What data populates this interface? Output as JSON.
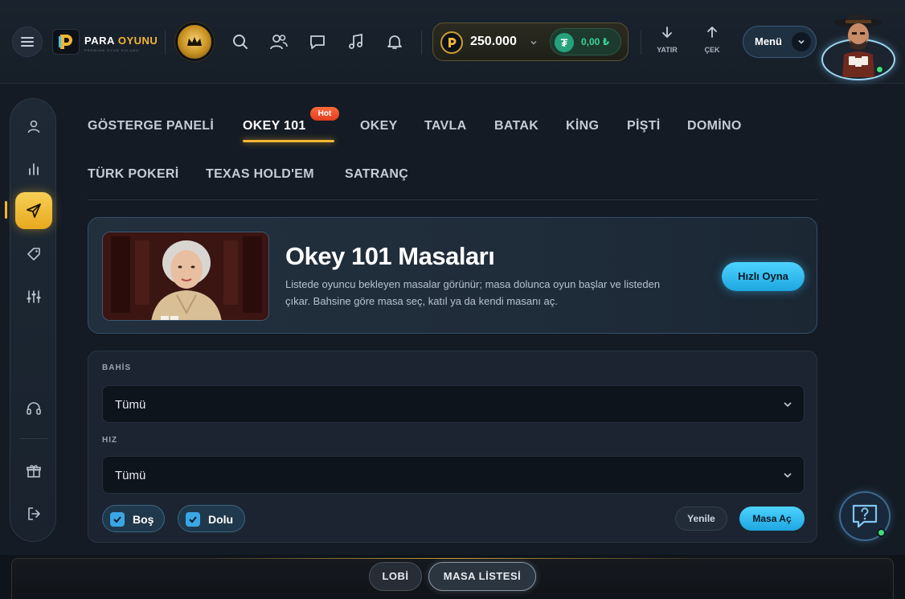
{
  "header": {
    "logo_word1": "PARA",
    "logo_word2": "OYUNU",
    "logo_tagline": "PREMIUM OYUN KULUBU",
    "balance": "250.000",
    "usdt_balance": "0,00 ₺",
    "deposit_label": "YATIR",
    "withdraw_label": "ÇEK",
    "menu_label": "Menü"
  },
  "tabs": {
    "items": [
      {
        "label": "GÖSTERGE PANELİ"
      },
      {
        "label": "OKEY 101"
      },
      {
        "label": "OKEY"
      },
      {
        "label": "TAVLA"
      },
      {
        "label": "BATAK"
      },
      {
        "label": "KİNG"
      },
      {
        "label": "PİŞTİ"
      },
      {
        "label": "DOMİNO"
      },
      {
        "label": "TÜRK POKERİ"
      },
      {
        "label": "TEXAS HOLD'EM"
      },
      {
        "label": "SATRANÇ"
      }
    ],
    "active": "OKEY 101",
    "hot_badge": "Hot"
  },
  "hero": {
    "title": "Okey 101 Masaları",
    "description": "Listede oyuncu bekleyen masalar görünür; masa dolunca oyun başlar ve listeden çıkar. Bahsine göre masa seç, katıl ya da kendi masanı aç.",
    "quick_play_label": "Hızlı Oyna"
  },
  "filters": {
    "bet_label": "BAHİS",
    "bet_value": "Tümü",
    "speed_label": "HIZ",
    "speed_value": "Tümü",
    "empty_label": "Boş",
    "empty_checked": true,
    "full_label": "Dolu",
    "full_checked": true,
    "refresh_label": "Yenile",
    "create_label": "Masa Aç"
  },
  "bottom_nav": {
    "lobby_label": "LOBİ",
    "table_list_label": "MASA LİSTESİ",
    "active": "MASA LİSTESİ"
  },
  "colors": {
    "accent_gold": "#f2b632",
    "accent_blue": "#3ec3f5",
    "usdt_green": "#27a17c",
    "hot_red": "#e8452a",
    "online_green": "#3ee07c"
  },
  "icons": {
    "sidebar": [
      "user-icon",
      "stats-icon",
      "send-icon",
      "tag-icon",
      "sliders-icon",
      "headset-icon",
      "gift-icon",
      "logout-icon"
    ],
    "header": [
      "menu-icon",
      "crown-icon",
      "search-icon",
      "users-icon",
      "chat-icon",
      "music-icon",
      "bell-icon"
    ]
  }
}
